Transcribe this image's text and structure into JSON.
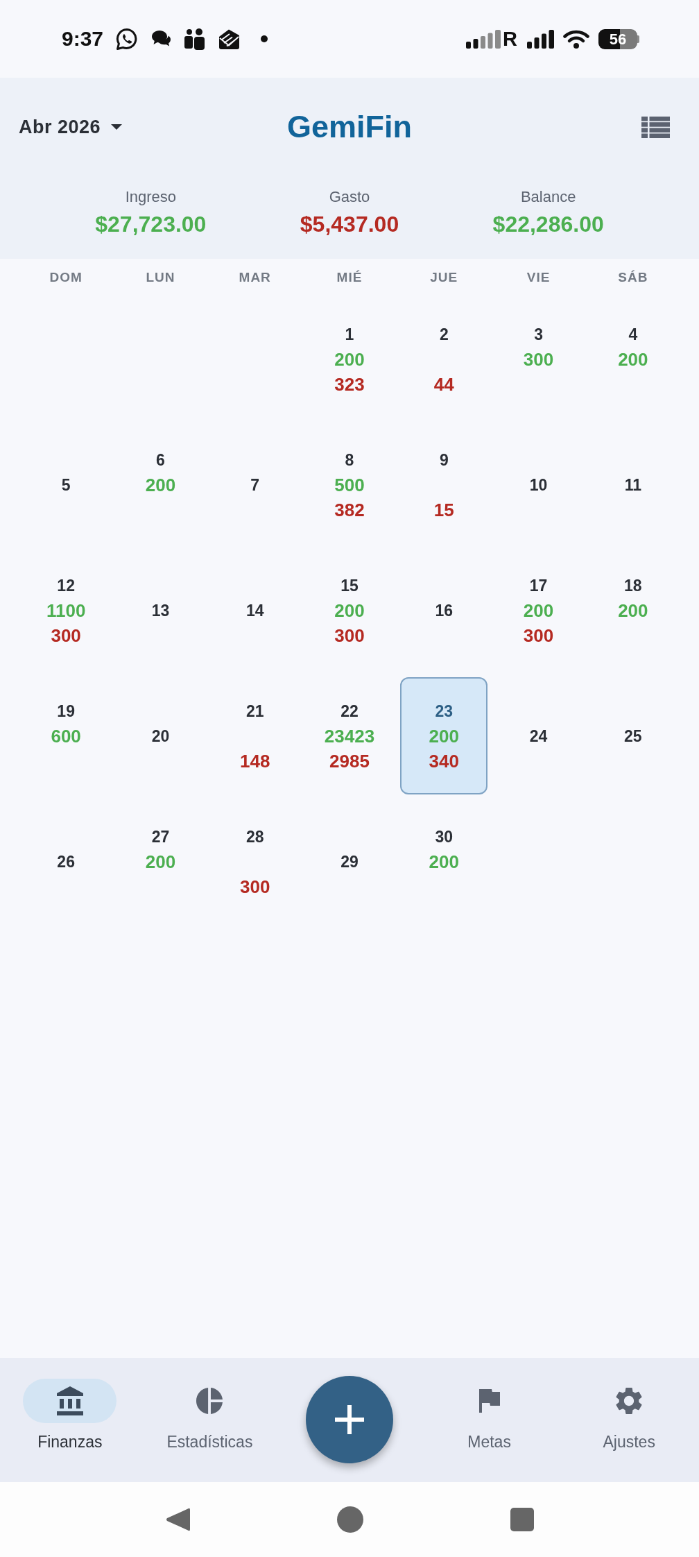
{
  "status_bar": {
    "time": "9:37",
    "network_label": "R",
    "battery": "56"
  },
  "header": {
    "month": "Abr 2026",
    "title": "GemiFin"
  },
  "summary": [
    {
      "label": "Ingreso",
      "value": "$27,723.00",
      "kind": "income"
    },
    {
      "label": "Gasto",
      "value": "$5,437.00",
      "kind": "expense"
    },
    {
      "label": "Balance",
      "value": "$22,286.00",
      "kind": "balance"
    }
  ],
  "calendar": {
    "weekdays": [
      "DOM",
      "LUN",
      "MAR",
      "MIÉ",
      "JUE",
      "VIE",
      "SÁB"
    ],
    "weeks": [
      [
        {
          "kind": "empty"
        },
        {
          "kind": "empty"
        },
        {
          "kind": "empty"
        },
        {
          "kind": "day",
          "day": "1",
          "income": "200",
          "expense": "323",
          "selected": false
        },
        {
          "kind": "day",
          "day": "2",
          "expense": "44",
          "selected": false
        },
        {
          "kind": "day",
          "day": "3",
          "income": "300",
          "selected": false
        },
        {
          "kind": "day",
          "day": "4",
          "income": "200",
          "selected": false
        }
      ],
      [
        {
          "kind": "day",
          "day": "5",
          "selected": false
        },
        {
          "kind": "day",
          "day": "6",
          "income": "200",
          "selected": false
        },
        {
          "kind": "day",
          "day": "7",
          "selected": false
        },
        {
          "kind": "day",
          "day": "8",
          "income": "500",
          "expense": "382",
          "selected": false
        },
        {
          "kind": "day",
          "day": "9",
          "expense": "15",
          "selected": false
        },
        {
          "kind": "day",
          "day": "10",
          "selected": false
        },
        {
          "kind": "day",
          "day": "11",
          "selected": false
        }
      ],
      [
        {
          "kind": "day",
          "day": "12",
          "income": "1100",
          "expense": "300",
          "selected": false
        },
        {
          "kind": "day",
          "day": "13",
          "selected": false
        },
        {
          "kind": "day",
          "day": "14",
          "selected": false
        },
        {
          "kind": "day",
          "day": "15",
          "income": "200",
          "expense": "300",
          "selected": false
        },
        {
          "kind": "day",
          "day": "16",
          "selected": false
        },
        {
          "kind": "day",
          "day": "17",
          "income": "200",
          "expense": "300",
          "selected": false
        },
        {
          "kind": "day",
          "day": "18",
          "income": "200",
          "selected": false
        }
      ],
      [
        {
          "kind": "day",
          "day": "19",
          "income": "600",
          "selected": false
        },
        {
          "kind": "day",
          "day": "20",
          "selected": false
        },
        {
          "kind": "day",
          "day": "21",
          "expense": "148",
          "selected": false
        },
        {
          "kind": "day",
          "day": "22",
          "income": "23423",
          "expense": "2985",
          "selected": false
        },
        {
          "kind": "day",
          "day": "23",
          "income": "200",
          "expense": "340",
          "selected": true
        },
        {
          "kind": "day",
          "day": "24",
          "selected": false
        },
        {
          "kind": "day",
          "day": "25",
          "selected": false
        }
      ],
      [
        {
          "kind": "day",
          "day": "26",
          "selected": false
        },
        {
          "kind": "day",
          "day": "27",
          "income": "200",
          "selected": false
        },
        {
          "kind": "day",
          "day": "28",
          "expense": "300",
          "selected": false
        },
        {
          "kind": "day",
          "day": "29",
          "selected": false
        },
        {
          "kind": "day",
          "day": "30",
          "income": "200",
          "selected": false
        },
        {
          "kind": "empty"
        },
        {
          "kind": "empty"
        }
      ]
    ]
  },
  "nav": {
    "items": [
      {
        "label": "Finanzas",
        "selected": true
      },
      {
        "label": "Estadísticas",
        "selected": false
      },
      {
        "label": "Metas",
        "selected": false
      },
      {
        "label": "Ajustes",
        "selected": false
      }
    ]
  }
}
